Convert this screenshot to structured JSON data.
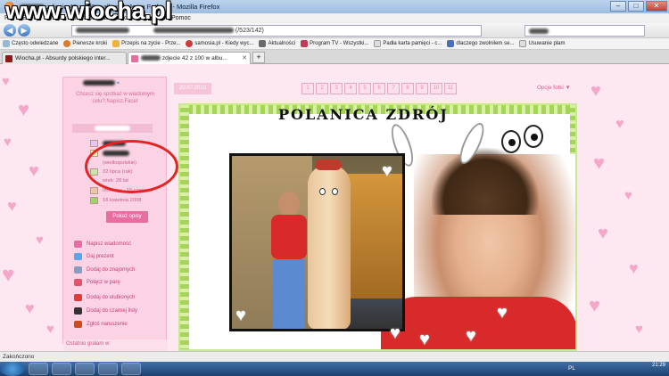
{
  "window": {
    "title": "zdjecie 42 z 100 w albumie Je na Fotka.pl - Mozilla Firefox",
    "controls": {
      "minimize": "–",
      "maximize": "□",
      "close": "✕"
    }
  },
  "watermark": "www.wiocha.pl",
  "menu": [
    "Plik",
    "Edycja",
    "Widok",
    "Historia",
    "Zakładki",
    "Narzędzia",
    "Pomoc"
  ],
  "nav": {
    "back": "◀",
    "forward": "▶",
    "url_suffix": "(/523/142)",
    "search_placeholder": ""
  },
  "bookmarks": [
    {
      "label": "Często odwiedzane",
      "icon": "bookmark-icon",
      "color": "#9bb7d8"
    },
    {
      "label": "Pierwsze kroki",
      "icon": "firefox-icon",
      "color": "#e07a2a"
    },
    {
      "label": "Przepis na zycie - Prze...",
      "icon": "tv-icon",
      "color": "#f0b23a"
    },
    {
      "label": "samosia.pl - Kiedy wyc...",
      "icon": "heart-icon",
      "color": "#d23a3a"
    },
    {
      "label": "Aktualności",
      "icon": "feed-icon",
      "color": "#6a6a6a"
    },
    {
      "label": "Program TV - Wszystki...",
      "icon": "tv-icon",
      "color": "#c23a5a"
    },
    {
      "label": "Padła karta pamięci - c...",
      "icon": "page-icon",
      "color": "#dddddd"
    },
    {
      "label": "dlaczego zwolnilem se...",
      "icon": "page-icon",
      "color": "#4a6fb8"
    },
    {
      "label": "Usuwanie plam",
      "icon": "page-icon",
      "color": "#dddddd"
    }
  ],
  "tabs": [
    {
      "label": "Wiocha.pl - Absurdy polskiego inter...",
      "active": false,
      "color": "#8b1b1b"
    },
    {
      "label": "zdjecie 42 z 100 w albu...",
      "active": true,
      "color": "#e86ea0"
    }
  ],
  "sidebar": {
    "status_message": "Chcesz się spotkać w wiadomym celu?,Napisz,Facet",
    "info": [
      {
        "text": "(wielkopolskie)",
        "icon": "location-icon"
      },
      {
        "text": "32 lipca (rak)",
        "icon": "calendar-icon"
      },
      {
        "text": "wiek: 28 lat",
        "icon": "age-icon"
      },
      {
        "text": "Imieniny - 15 czerwca",
        "icon": "cake-icon"
      },
      {
        "text": "16 kwietnia 2008",
        "icon": "join-icon"
      }
    ],
    "show_desc_button": "Pokaż opisy",
    "actions": [
      {
        "label": "Napisz wiadomość",
        "icon": "message-icon",
        "color": "#e76ca0"
      },
      {
        "label": "Daj prezent",
        "icon": "gift-icon",
        "color": "#58a6e8"
      },
      {
        "label": "Dodaj do znajomych",
        "icon": "friends-icon",
        "color": "#8a9bc0"
      },
      {
        "label": "Połącz w parę",
        "icon": "pair-icon",
        "color": "#e8516a"
      },
      {
        "label": "Dodaj do ulubionych",
        "icon": "favorite-icon",
        "color": "#e03a3a"
      },
      {
        "label": "Dodaj do czarnej listy",
        "icon": "blacklist-icon",
        "color": "#333333"
      },
      {
        "label": "Zgłoś naruszenie",
        "icon": "report-icon",
        "color": "#d04a20"
      }
    ],
    "last_played": "Ostatnio grałam w:"
  },
  "photo_page": {
    "date": "20.07.2010",
    "pages": [
      "1",
      "2",
      "3",
      "4",
      "5",
      "6",
      "7",
      "8",
      "9",
      "10",
      "11"
    ],
    "options": "Opcje fotki ▼",
    "photo_title": "POLANICA ZDRÓJ"
  },
  "statusbar": "Zakończono",
  "taskbar": {
    "lang": "PL",
    "time": "21:29"
  }
}
